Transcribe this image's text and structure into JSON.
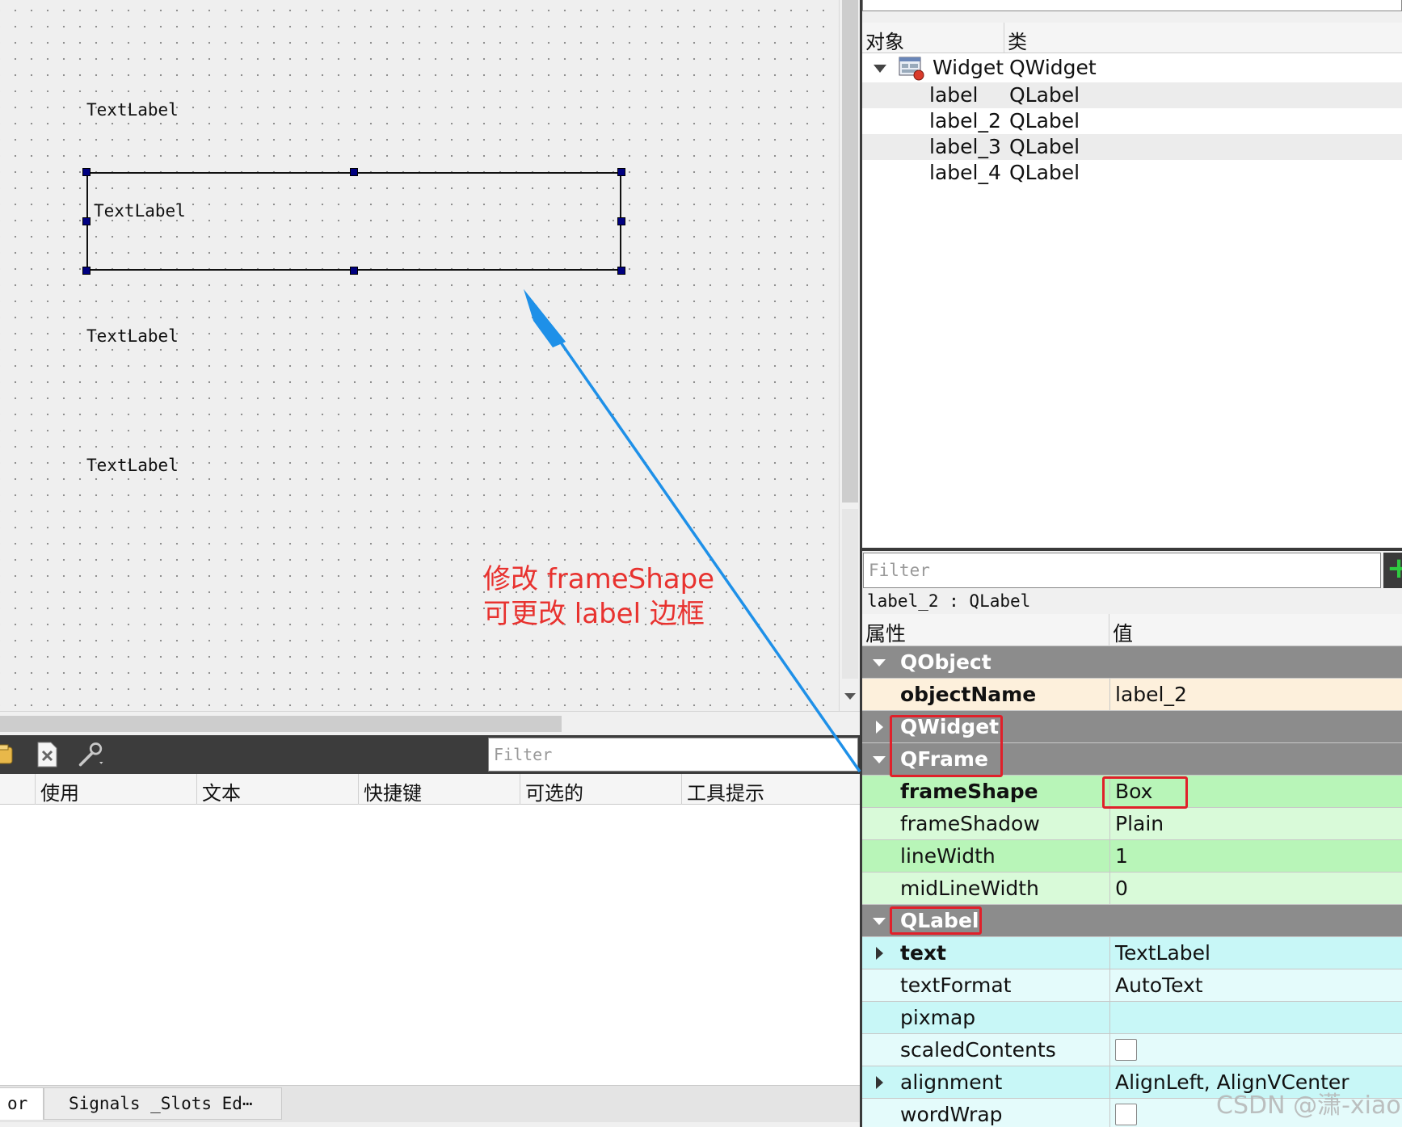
{
  "canvas": {
    "labels": [
      "TextLabel",
      "TextLabel",
      "TextLabel",
      "TextLabel"
    ],
    "annotation_line1": "修改 frameShape",
    "annotation_line2": "可更改 label 边框"
  },
  "action_editor": {
    "filter_placeholder": "Filter",
    "columns": [
      "使用",
      "文本",
      "快捷键",
      "可选的",
      "工具提示"
    ],
    "tabs": [
      "or",
      "Signals _Slots Ed⋯"
    ]
  },
  "object_inspector": {
    "filter_placeholder": "Filter",
    "columns": [
      "对象",
      "类"
    ],
    "root": {
      "object": "Widget",
      "class": "QWidget"
    },
    "children": [
      {
        "object": "label",
        "class": "QLabel"
      },
      {
        "object": "label_2",
        "class": "QLabel"
      },
      {
        "object": "label_3",
        "class": "QLabel"
      },
      {
        "object": "label_4",
        "class": "QLabel"
      }
    ]
  },
  "property_editor": {
    "filter_placeholder": "Filter",
    "plus_label": "+",
    "object_title": "label_2 : QLabel",
    "columns": [
      "属性",
      "值"
    ],
    "groups": {
      "qobject": "QObject",
      "qwidget": "QWidget",
      "qframe": "QFrame",
      "qlabel": "QLabel"
    },
    "properties": {
      "objectName": {
        "name": "objectName",
        "value": "label_2"
      },
      "frameShape": {
        "name": "frameShape",
        "value": "Box"
      },
      "frameShadow": {
        "name": "frameShadow",
        "value": "Plain"
      },
      "lineWidth": {
        "name": "lineWidth",
        "value": "1"
      },
      "midLineWidth": {
        "name": "midLineWidth",
        "value": "0"
      },
      "text": {
        "name": "text",
        "value": "TextLabel"
      },
      "textFormat": {
        "name": "textFormat",
        "value": "AutoText"
      },
      "pixmap": {
        "name": "pixmap",
        "value": ""
      },
      "scaledContents": {
        "name": "scaledContents",
        "checked": false
      },
      "alignment": {
        "name": "alignment",
        "value": "AlignLeft, AlignVCenter"
      },
      "wordWrap": {
        "name": "wordWrap",
        "checked": false
      }
    }
  },
  "watermark": "CSDN @潇-xiao",
  "colors": {
    "group_bg": "#8c8c8c",
    "qobject_row": "#fdf0dc",
    "qframe_row": "#b8f5b8",
    "qframe_row_alt": "#d9fad9",
    "qlabel_row": "#c8f7f7",
    "qlabel_row_alt": "#e4fbfb",
    "highlight": "#e0202a",
    "arrow": "#1e90e8",
    "annotation": "#e8322f"
  },
  "icons": [
    "widget-icon",
    "action-icon",
    "delete-icon",
    "wrench-icon",
    "add-icon"
  ]
}
